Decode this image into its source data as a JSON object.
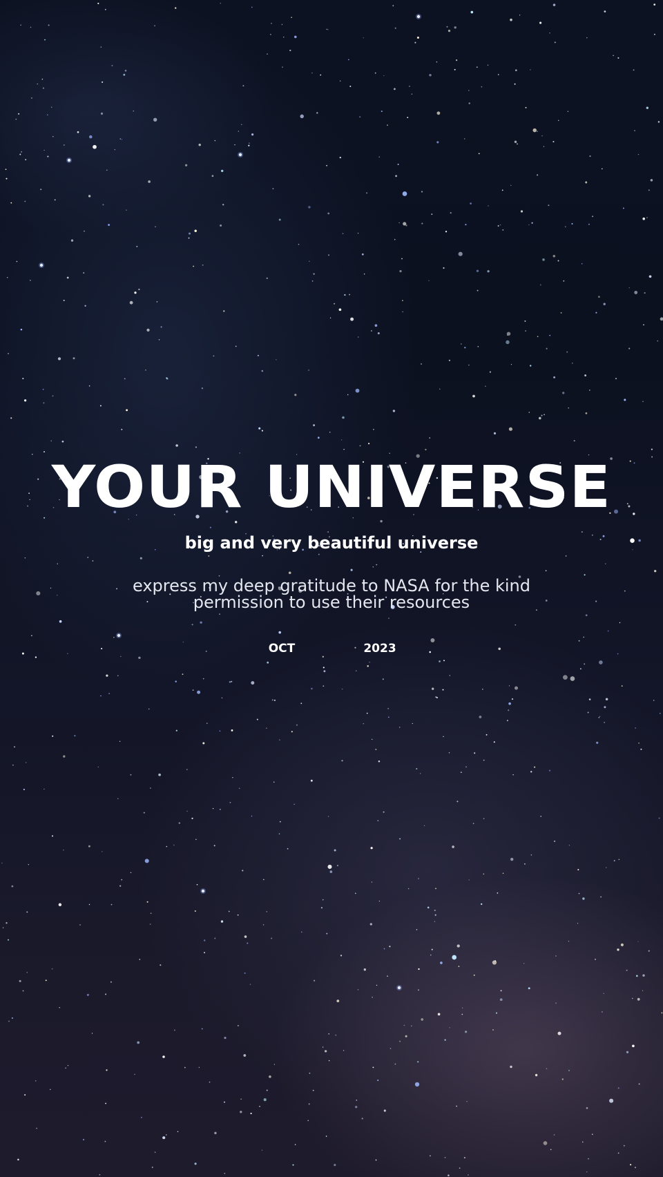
{
  "poster": {
    "headline": "YOUR UNIVERSE",
    "subtitle": "big and very beautiful universe",
    "gratitude_line_1": "express my deep gratitude to NASA for the kind",
    "gratitude_line_2": "permission to use their resources",
    "month": "OCT",
    "year": "2023"
  },
  "background": {
    "type": "starry-night-sky",
    "colors": {
      "sky_top": "#0d1222",
      "sky_bottom": "#1e1b2c",
      "nebula_glow": "#786078",
      "text": "#ffffff"
    }
  }
}
